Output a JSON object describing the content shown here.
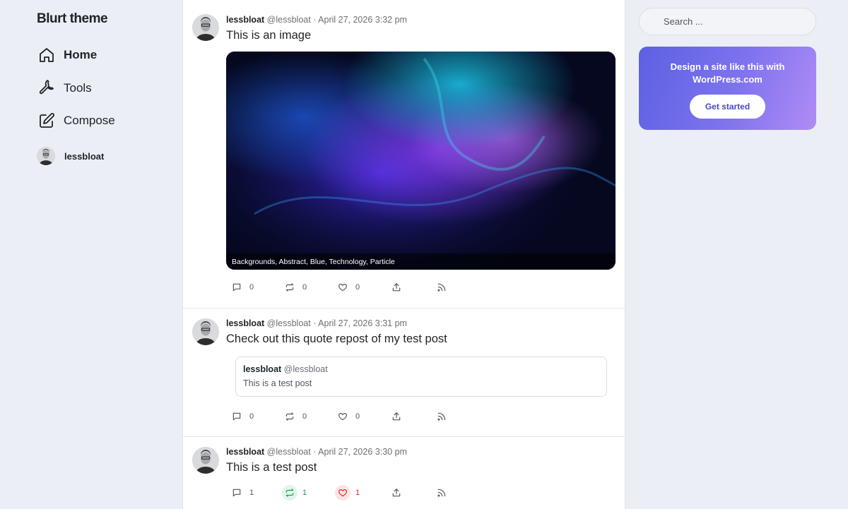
{
  "site": {
    "title": "Blurt theme"
  },
  "nav": {
    "items": [
      {
        "label": "Home",
        "icon": "home-icon",
        "active": true
      },
      {
        "label": "Tools",
        "icon": "wrench-icon",
        "active": false
      },
      {
        "label": "Compose",
        "icon": "compose-icon",
        "active": false
      }
    ],
    "profile": {
      "name": "lessbloat"
    }
  },
  "posts": [
    {
      "author": "lessbloat",
      "handle": "@lessbloat",
      "separator": "·",
      "date": "April 27, 2026 3:32 pm",
      "text": "This is an image",
      "media_caption": "Backgrounds, Abstract, Blue, Technology, Particle",
      "counts": {
        "reply": "0",
        "boost": "0",
        "like": "0"
      }
    },
    {
      "author": "lessbloat",
      "handle": "@lessbloat",
      "separator": "·",
      "date": "April 27, 2026 3:31 pm",
      "text": "Check out this quote repost of my test post",
      "quote": {
        "author": "lessbloat",
        "handle": "@lessbloat",
        "text": "This is a test post"
      },
      "counts": {
        "reply": "0",
        "boost": "0",
        "like": "0"
      }
    },
    {
      "author": "lessbloat",
      "handle": "@lessbloat",
      "separator": "·",
      "date": "April 27, 2026 3:30 pm",
      "text": "This is a test post",
      "counts": {
        "reply": "1",
        "boost": "1",
        "like": "1"
      }
    }
  ],
  "search": {
    "placeholder": "Search ..."
  },
  "promo": {
    "text": "Design a site like this with WordPress.com",
    "button": "Get started"
  },
  "colors": {
    "accent": "#5b61e2",
    "boost": "#16a34a",
    "like": "#dc2626",
    "background": "#eceef6"
  }
}
